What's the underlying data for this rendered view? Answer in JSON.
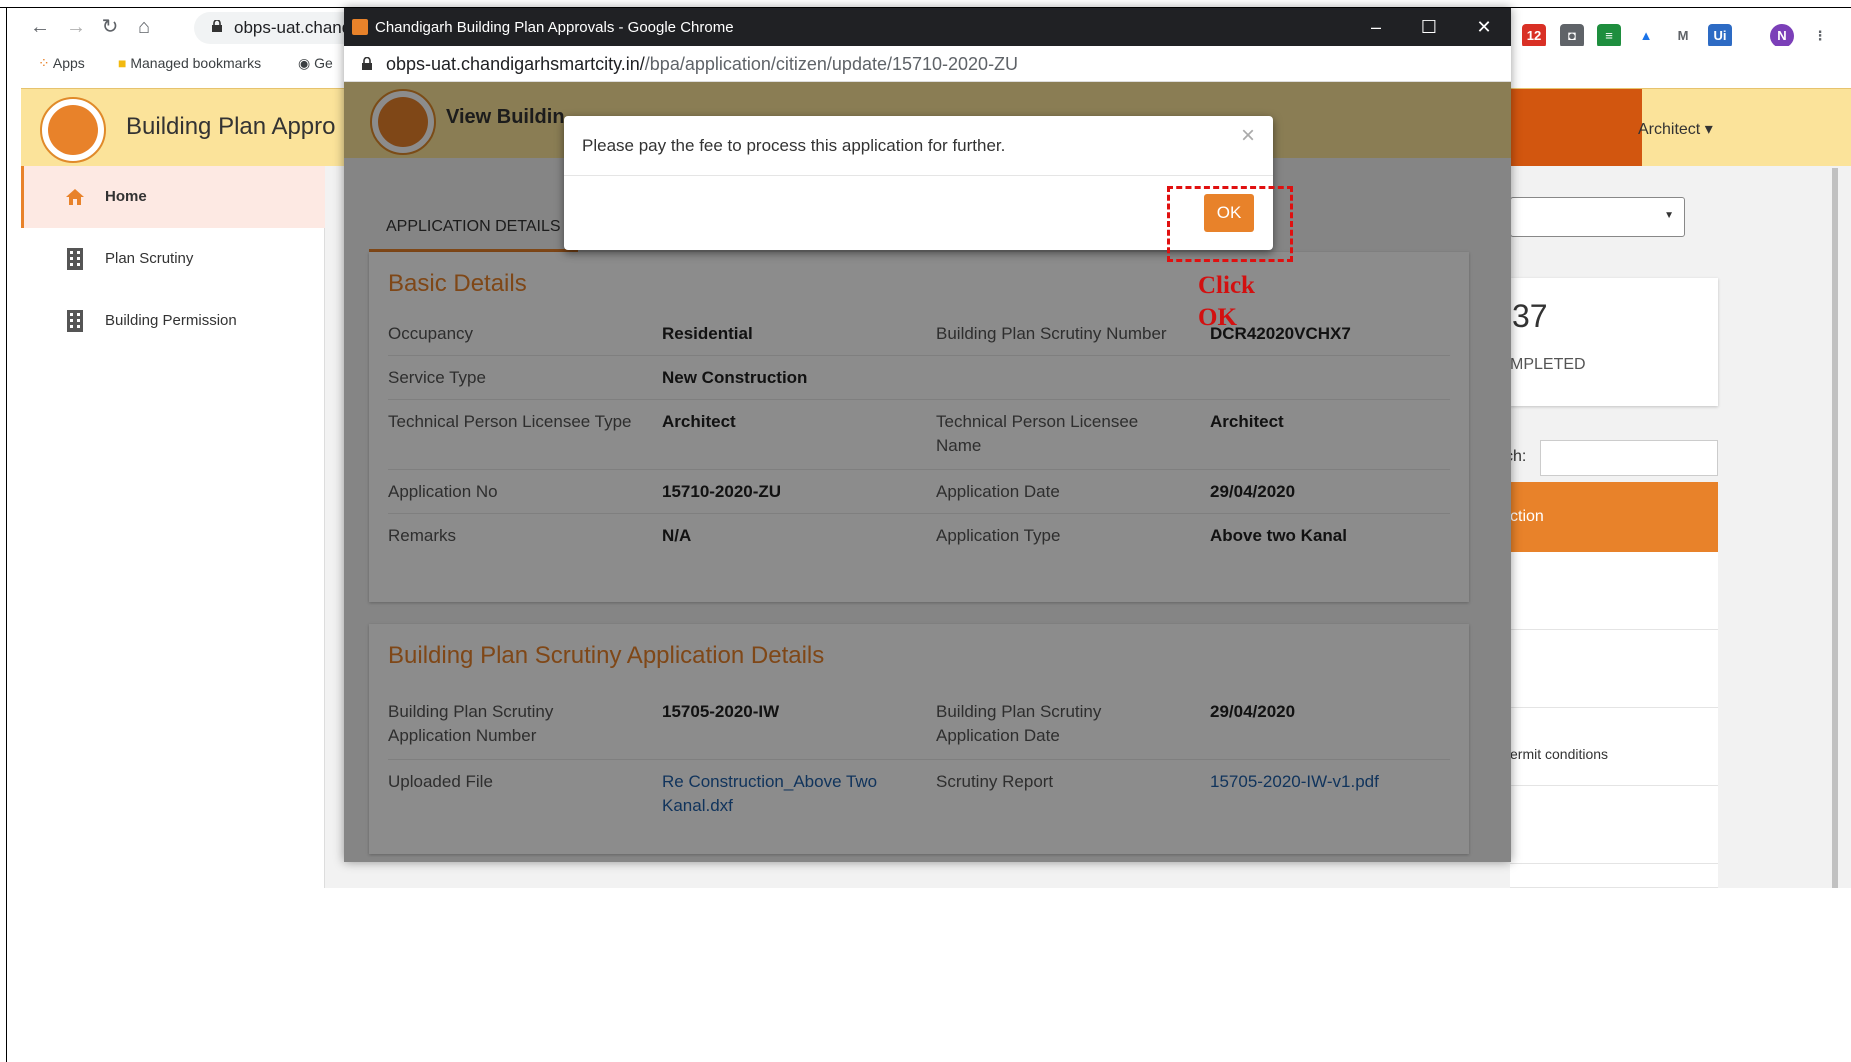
{
  "browser": {
    "omnibox_url": "obps-uat.chandi",
    "bookmarks": [
      {
        "label": "Apps"
      },
      {
        "label": "Managed bookmarks"
      },
      {
        "label": "Ge"
      }
    ],
    "profile_initial": "N",
    "gmail_badge": "12"
  },
  "app": {
    "title": "Building Plan Appro",
    "user_menu": "Architect",
    "sidebar": [
      {
        "label": "Home",
        "active": true
      },
      {
        "label": "Plan Scrutiny",
        "active": false
      },
      {
        "label": "Building Permission",
        "active": false
      }
    ],
    "stat_number": "37",
    "stat_label": "MPLETED",
    "search_label": "ch:",
    "table_header": "ction",
    "row_text": "ermit conditions"
  },
  "popup": {
    "window_title": "Chandigarh Building Plan Approvals - Google Chrome",
    "url_host": "obps-uat.chandigarhsmartcity.in/",
    "url_path": "/bpa/application/citizen/update/15710-2020-ZU",
    "heading": "View Buildin",
    "tab": "APPLICATION DETAILS",
    "basic_details": {
      "title": "Basic Details",
      "rows": [
        {
          "l1": "Occupancy",
          "v1": "Residential",
          "l2": "Building Plan Scrutiny Number",
          "v2": "DCR42020VCHX7"
        },
        {
          "l1": "Service Type",
          "v1": "New Construction",
          "l2": "",
          "v2": ""
        },
        {
          "l1": "Technical Person Licensee Type",
          "v1": "Architect",
          "l2": "Technical Person Licensee Name",
          "v2": "Architect"
        },
        {
          "l1": "Application No",
          "v1": "15710-2020-ZU",
          "l2": "Application Date",
          "v2": "29/04/2020"
        },
        {
          "l1": "Remarks",
          "v1": "N/A",
          "l2": "Application Type",
          "v2": "Above two Kanal"
        }
      ]
    },
    "scrutiny_details": {
      "title": "Building Plan Scrutiny Application Details",
      "rows": [
        {
          "l1": "Building Plan Scrutiny Application Number",
          "v1": "15705-2020-IW",
          "l2": "Building Plan Scrutiny Application Date",
          "v2": "29/04/2020"
        },
        {
          "l1": "Uploaded File",
          "v1": "Re Construction_Above Two Kanal.dxf",
          "l2": "Scrutiny Report",
          "v2": "15705-2020-IW-v1.pdf"
        }
      ]
    }
  },
  "dialog": {
    "message": "Please pay the fee to process this application for further.",
    "close": "×",
    "ok_label": "OK"
  },
  "annotation": {
    "text": "Click OK",
    "color": "#d31010"
  },
  "colors": {
    "accent": "#e8822a",
    "header": "#fbe39a",
    "link": "#1f5fa8"
  }
}
